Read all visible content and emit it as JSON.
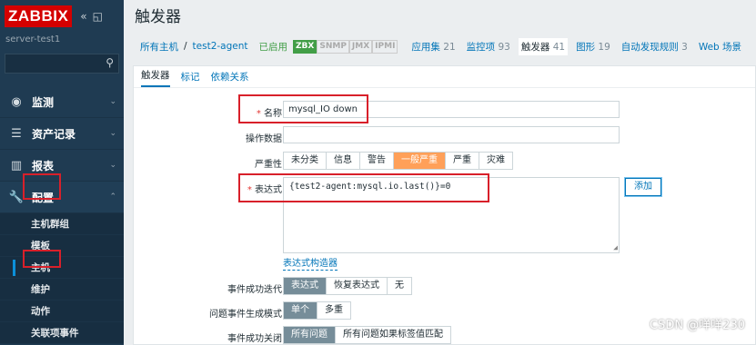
{
  "sidebar": {
    "logo": "ZABBIX",
    "collapse_icon": "double-chevron-left-icon",
    "kiosk_icon": "kiosk-icon",
    "server_name": "server-test1",
    "search_placeholder": "",
    "menu": [
      {
        "label": "监测",
        "icon": "eye-icon"
      },
      {
        "label": "资产记录",
        "icon": "list-icon"
      },
      {
        "label": "报表",
        "icon": "chart-icon"
      },
      {
        "label": "配置",
        "icon": "wrench-icon"
      }
    ],
    "submenu": [
      "主机群组",
      "模板",
      "主机",
      "维护",
      "动作",
      "关联项事件"
    ]
  },
  "page": {
    "title": "触发器"
  },
  "breadcrumb": {
    "all_hosts": "所有主机",
    "sep": "/",
    "host": "test2-agent",
    "enabled": "已启用",
    "badges": [
      "ZBX",
      "SNMP",
      "JMX",
      "IPMI"
    ],
    "tabs": [
      {
        "label": "应用集",
        "count": "21"
      },
      {
        "label": "监控项",
        "count": "93"
      },
      {
        "label": "触发器",
        "count": "41"
      },
      {
        "label": "图形",
        "count": "19"
      },
      {
        "label": "自动发现规则",
        "count": "3"
      },
      {
        "label": "Web 场景",
        "count": ""
      }
    ]
  },
  "form_tabs": [
    "触发器",
    "标记",
    "依赖关系"
  ],
  "form": {
    "name_label": "名称",
    "name_value": "mysql_IO down",
    "opdata_label": "操作数据",
    "opdata_value": "",
    "severity_label": "严重性",
    "severity_options": [
      "未分类",
      "信息",
      "警告",
      "一般严重",
      "严重",
      "灾难"
    ],
    "severity_selected": "一般严重",
    "expression_label": "表达式",
    "expression_value": "{test2-agent:mysql.io.last()}=0",
    "add_button": "添加",
    "constructor_link": "表达式构造器",
    "ok_event_label": "事件成功迭代",
    "ok_event_options": [
      "表达式",
      "恢复表达式",
      "无"
    ],
    "ok_event_selected": "表达式",
    "problem_mode_label": "问题事件生成模式",
    "problem_mode_options": [
      "单个",
      "多重"
    ],
    "problem_mode_selected": "单个",
    "ok_close_label": "事件成功关闭",
    "ok_close_options": [
      "所有问题",
      "所有问题如果标签值匹配"
    ],
    "ok_close_selected": "所有问题",
    "required_mark": "*"
  },
  "watermark": "CSDN @咩咩230",
  "colors": {
    "sidebar_bg": "#1f3b52",
    "logo_red": "#d40000",
    "link_blue": "#0275b8",
    "severity_average": "#ffa059",
    "highlight_red": "#d8202a"
  }
}
